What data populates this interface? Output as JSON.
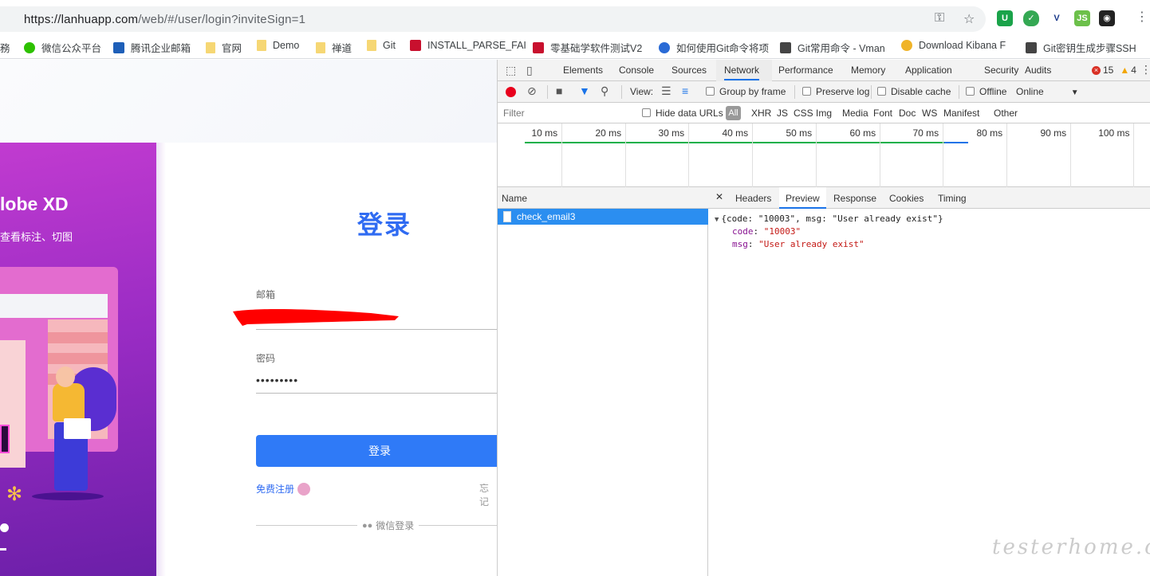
{
  "browser": {
    "url_host": "https://lanhuapp.com",
    "url_path": "/web/#/user/login?inviteSign=1"
  },
  "bookmarks": [
    {
      "label": "務",
      "icon": "none"
    },
    {
      "label": "微信公众平台",
      "icon": "wechat-icon"
    },
    {
      "label": "腾讯企业邮箱",
      "icon": "mail-icon"
    },
    {
      "label": "官网",
      "icon": "folder-icon"
    },
    {
      "label": "Demo",
      "icon": "folder-icon"
    },
    {
      "label": "禅道",
      "icon": "folder-icon"
    },
    {
      "label": "Git",
      "icon": "folder-icon"
    },
    {
      "label": "INSTALL_PARSE_FAI",
      "icon": "red-c-icon"
    },
    {
      "label": "零基础学软件测试V2",
      "icon": "red-c-icon"
    },
    {
      "label": "如何使用Git命令将项",
      "icon": "paw-icon"
    },
    {
      "label": "Git常用命令 - Vman",
      "icon": "v-icon"
    },
    {
      "label": "Download Kibana F",
      "icon": "kibana-icon"
    },
    {
      "label": "Git密钥生成步骤SSH",
      "icon": "v-icon"
    }
  ],
  "page": {
    "banner_title": "lobe XD",
    "banner_sub": "查看标注、切图",
    "login_title": "登录",
    "email_label": "邮箱",
    "password_label": "密码",
    "password_value": "•••••••••",
    "login_button": "登录",
    "register_link": "免费注册",
    "forgot_link": "忘记",
    "wechat_login": "微信登录"
  },
  "devtools": {
    "tabs": [
      "Elements",
      "Console",
      "Sources",
      "Network",
      "Performance",
      "Memory",
      "Application",
      "Security",
      "Audits"
    ],
    "active_tab": "Network",
    "errors": "15",
    "warnings": "4",
    "toolbar": {
      "view_label": "View:",
      "group_by_frame": "Group by frame",
      "preserve_log": "Preserve log",
      "disable_cache": "Disable cache",
      "offline": "Offline",
      "online": "Online"
    },
    "filter": {
      "placeholder": "Filter",
      "hide_data_urls": "Hide data URLs",
      "all": "All",
      "types": [
        "XHR",
        "JS",
        "CSS",
        "Img",
        "Media",
        "Font",
        "Doc",
        "WS",
        "Manifest",
        "Other"
      ]
    },
    "timeline_labels": [
      "10 ms",
      "20 ms",
      "30 ms",
      "40 ms",
      "50 ms",
      "60 ms",
      "70 ms",
      "80 ms",
      "90 ms",
      "100 ms"
    ],
    "name_header": "Name",
    "request_name": "check_email3",
    "detail_tabs": [
      "Headers",
      "Preview",
      "Response",
      "Cookies",
      "Timing"
    ],
    "active_detail_tab": "Preview",
    "preview": {
      "summary": "{code: \"10003\", msg: \"User already exist\"}",
      "code_key": "code",
      "code_value": "\"10003\"",
      "msg_key": "msg",
      "msg_value": "\"User already exist\""
    }
  },
  "watermark": "testerhome.com"
}
